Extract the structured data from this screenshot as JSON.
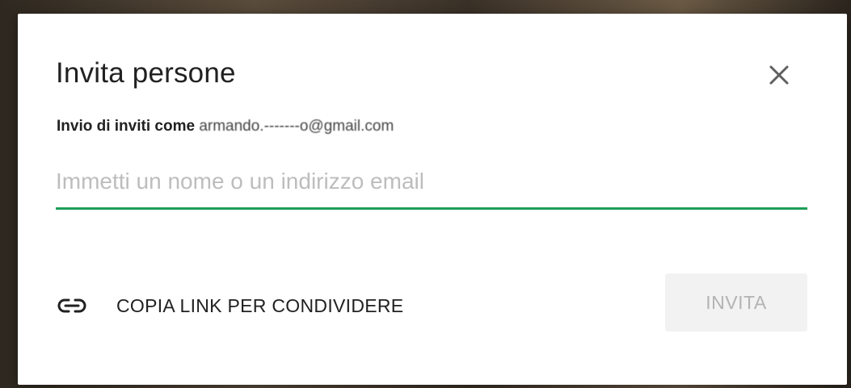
{
  "dialog": {
    "title": "Invita persone",
    "close_icon": "close-icon",
    "sender_prefix": "Invio di inviti come ",
    "sender_email": "armando.-------o@gmail.com",
    "input": {
      "value": "",
      "placeholder": "Immetti un nome o un indirizzo email"
    },
    "copy_link": {
      "icon": "link-icon",
      "label": "COPIA LINK PER CONDIVIDERE"
    },
    "invite_button": {
      "label": "INVITA",
      "disabled": true
    }
  },
  "colors": {
    "accent": "#1e9e57",
    "text": "#212121",
    "placeholder": "#bdbdbd",
    "disabled_button_bg": "#f2f2f2",
    "disabled_button_text": "#b3b3b3"
  }
}
